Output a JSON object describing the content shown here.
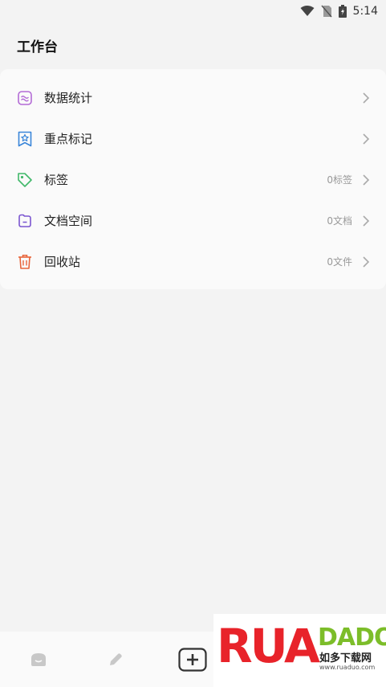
{
  "status_bar": {
    "time": "5:14"
  },
  "header": {
    "title": "工作台"
  },
  "menu": [
    {
      "label": "数据统计",
      "count": "",
      "icon": "chart-icon",
      "color": "#b36bd6"
    },
    {
      "label": "重点标记",
      "count": "",
      "icon": "star-bookmark-icon",
      "color": "#3a86d9"
    },
    {
      "label": "标签",
      "count": "0标签",
      "icon": "tag-icon",
      "color": "#41b86a"
    },
    {
      "label": "文档空间",
      "count": "0文档",
      "icon": "folder-icon",
      "color": "#7b56d0"
    },
    {
      "label": "回收站",
      "count": "0文件",
      "icon": "trash-icon",
      "color": "#e8643a"
    }
  ],
  "bottom_nav": [
    {
      "icon": "home-icon"
    },
    {
      "icon": "edit-icon"
    },
    {
      "icon": "add-icon"
    }
  ],
  "watermark": {
    "letters": "RUA",
    "brand": "DADO",
    "cn": "如多下载网",
    "url": "www.ruaduo.com"
  }
}
